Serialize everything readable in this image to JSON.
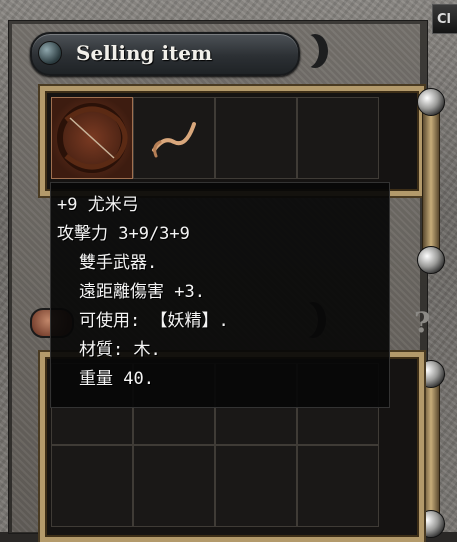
{
  "window": {
    "title": "Selling item",
    "close_label": "Cl",
    "help_symbol": "?"
  },
  "selling_slots": [
    {
      "icon": "bow-icon",
      "selected": true
    },
    {
      "icon": "crossbow-icon",
      "selected": false
    },
    {
      "icon": "",
      "selected": false
    },
    {
      "icon": "",
      "selected": false
    }
  ],
  "tooltip": {
    "lines": [
      "+9 尤米弓",
      "攻擊力 3+9/3+9",
      "雙手武器.",
      "遠距離傷害 +3.",
      "可使用: 【妖精】.",
      "材質: 木.",
      "重量 40."
    ]
  },
  "colors": {
    "frame_stone": "#7b7874",
    "grid_border": "#b39a6b",
    "tooltip_bg": "#080808",
    "tooltip_text": "#f4f4f4",
    "selected_slot": "#7a3a22"
  }
}
